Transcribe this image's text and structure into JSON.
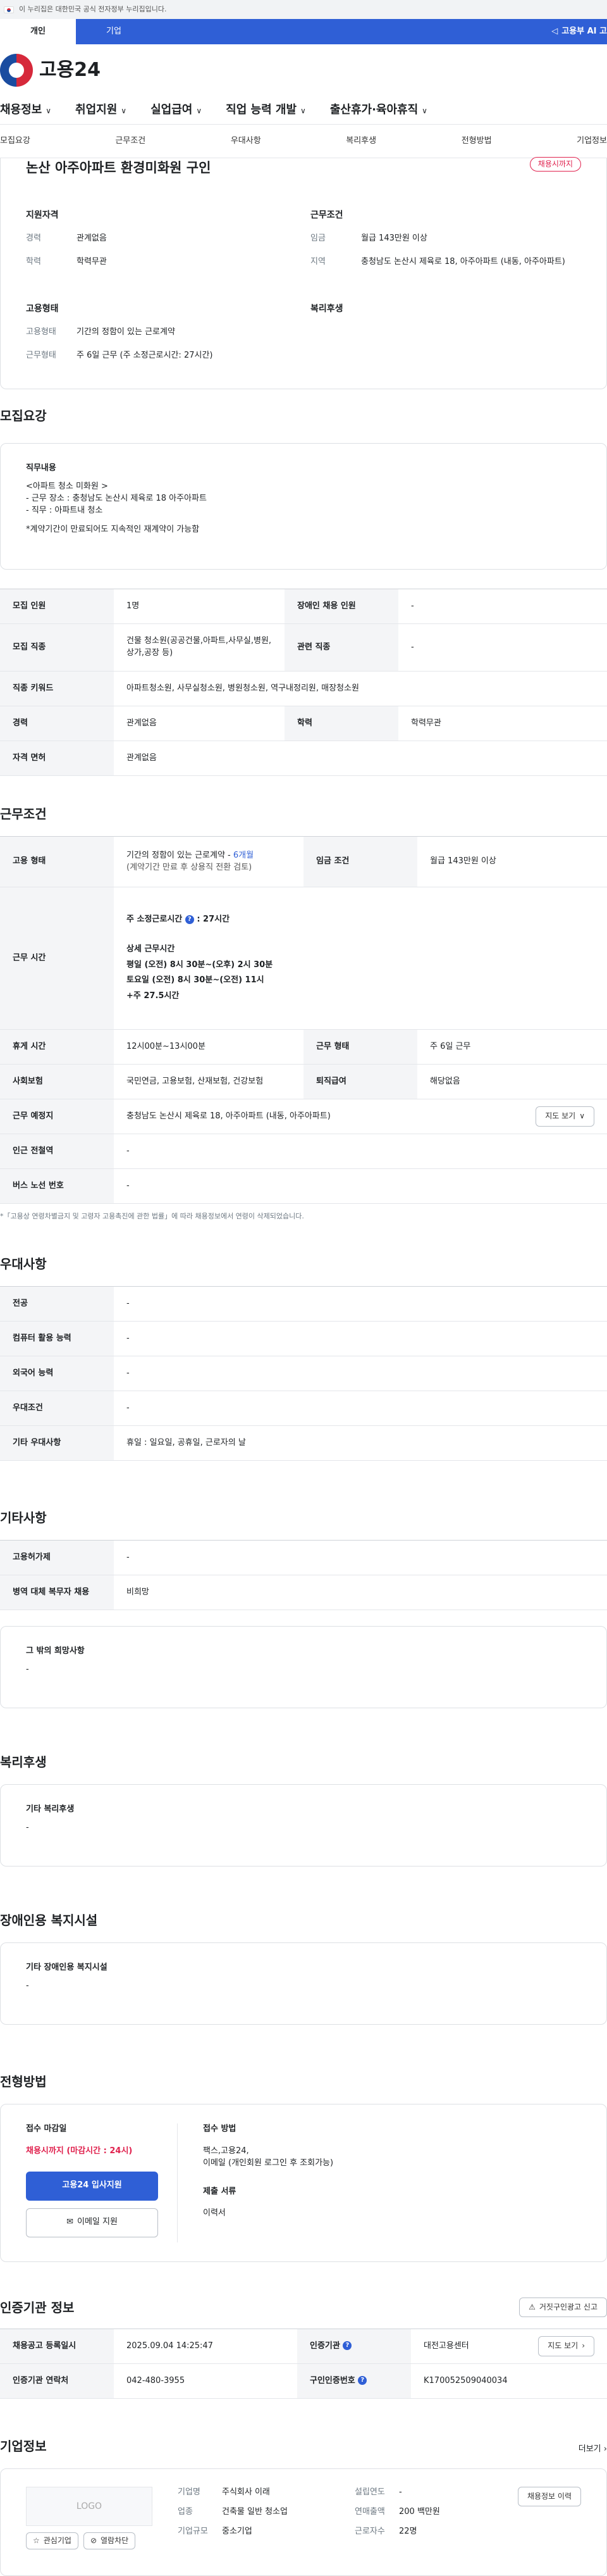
{
  "gov_banner": {
    "text": "이 누리집은 대한민국 공식 전자정부 누리집입니다."
  },
  "top_tabs": [
    {
      "label": "개인",
      "active": true
    },
    {
      "label": "기업",
      "active": false
    }
  ],
  "ai_link": "고용부 AI 고",
  "logo": {
    "text": "고용24"
  },
  "gnb": [
    "채용정보",
    "취업지원",
    "실업급여",
    "직업 능력 개발",
    "출산휴가·육아휴직"
  ],
  "subnav": [
    "모집요강",
    "근무조건",
    "우대사항",
    "복리후생",
    "전형방법",
    "기업정보"
  ],
  "job": {
    "title": "논산 아주아파트 환경미화원 구인",
    "status_badge": "채용시까지",
    "qual_title": "지원자격",
    "qual": [
      {
        "k": "경력",
        "v": "관계없음"
      },
      {
        "k": "학력",
        "v": "학력무관"
      }
    ],
    "cond_title": "근무조건",
    "cond": [
      {
        "k": "임금",
        "v": "월급 143만원 이상"
      },
      {
        "k": "지역",
        "v": "충청남도 논산시 제육로 18, 아주아파트 (내동, 아주아파트)"
      }
    ],
    "emp_title": "고용형태",
    "emp": [
      {
        "k": "고용형태",
        "v": "기간의 정함이 있는 근로계약"
      },
      {
        "k": "근무형태",
        "v": "주 6일 근무 (주 소정근로시간: 27시간)"
      }
    ],
    "welfare_title": "복리후생"
  },
  "recruit": {
    "heading": "모집요강",
    "duty_label": "직무내용",
    "duty_lines": [
      "<아파트 청소 미화원 >",
      "- 근무 장소 : 충청남도 논산시 제육로 18 아주아파트",
      "- 직무 : 아파트내 청소",
      "",
      "*계약기간이 만료되어도 지속적인 재계약이 가능함"
    ],
    "table": {
      "r1": {
        "k1": "모집 인원",
        "v1": "1명",
        "k2": "장애인 채용 인원",
        "v2": "-"
      },
      "r2": {
        "k1": "모집 직종",
        "v1": "건물 청소원(공공건물,아파트,사무실,병원,상가,공장 등)",
        "k2": "관련 직종",
        "v2": "-"
      },
      "r3": {
        "k1": "직종 키워드",
        "v1": "아파트청소원, 사무실청소원, 병원청소원, 역구내정리원, 매장청소원"
      },
      "r4": {
        "k1": "경력",
        "v1": "관계없음",
        "k2": "학력",
        "v2": "학력무관"
      },
      "r5": {
        "k1": "자격 면허",
        "v1": "관계없음"
      }
    }
  },
  "work": {
    "heading": "근무조건",
    "emp_type_k": "고용 형태",
    "emp_type_v1": "기간의 정함이 있는 근로계약 - ",
    "emp_type_months": "6개월",
    "emp_type_v2": "(계약기간 만료 후 상용직 전환 검토)",
    "wage_k": "임금 조건",
    "wage_v": "월급 143만원 이상",
    "hours_k": "근무 시간",
    "hours_main": "주 소정근로시간",
    "hours_main_val": ": 27시간",
    "hours_detail_label": "상세 근무시간",
    "hours_lines": [
      "평일 (오전) 8시 30분~(오후) 2시 30분",
      "토요일 (오전) 8시 30분~(오전) 11시",
      "+주 27.5시간"
    ],
    "break_k": "휴게 시간",
    "break_v": "12시00분~13시00분",
    "shift_k": "근무 형태",
    "shift_v": "주 6일 근무",
    "insurance_k": "사회보험",
    "insurance_v": "국민연금, 고용보험, 산재보험, 건강보험",
    "severance_k": "퇴직급여",
    "severance_v": "해당없음",
    "place_k": "근무 예정지",
    "place_v": "충청남도 논산시 제육로 18, 아주아파트 (내동, 아주아파트)",
    "map_btn": "지도 보기",
    "subway_k": "인근 전철역",
    "subway_v": "-",
    "bus_k": "버스 노선 번호",
    "bus_v": "-",
    "footnote": "「고용상 연령차별금지 및 고령자 고용촉진에 관한 법률」에 따라 채용정보에서 연령이 삭제되었습니다."
  },
  "pref": {
    "heading": "우대사항",
    "rows": [
      {
        "k": "전공",
        "v": "-"
      },
      {
        "k": "컴퓨터 활용 능력",
        "v": "-"
      },
      {
        "k": "외국어 능력",
        "v": "-"
      },
      {
        "k": "우대조건",
        "v": "-"
      },
      {
        "k": "기타 우대사항",
        "v": "휴일 : 일요일, 공휴일, 근로자의 날"
      }
    ]
  },
  "etc": {
    "heading": "기타사항",
    "rows": [
      {
        "k": "고용허가제",
        "v": "-"
      },
      {
        "k": "병역 대체 복무자 채용",
        "v": "비희망"
      }
    ],
    "other_label": "그 밖의 희망사항",
    "other_value": "-"
  },
  "welfare": {
    "heading": "복리후생",
    "label": "기타 복리후생",
    "value": "-"
  },
  "disab": {
    "heading": "장애인용 복지시설",
    "label": "기타 장애인용 복지시설",
    "value": "-"
  },
  "process": {
    "heading": "전형방법",
    "deadline_label": "접수 마감일",
    "deadline_value": "채용시까지 (마감시간 : 24시)",
    "apply_btn": "고용24 입사지원",
    "email_btn": "이메일 지원",
    "method_label": "접수 방법",
    "method_lines": [
      "팩스,고용24,",
      "이메일 (개인회원 로그인 후 조회가능)"
    ],
    "docs_label": "제출 서류",
    "docs_value": "이력서"
  },
  "agency": {
    "heading": "인증기관 정보",
    "report_btn": "거짓구인광고 신고",
    "reg_k": "채용공고 등록일시",
    "reg_v": "2025.09.04 14:25:47",
    "org_k": "인증기관",
    "org_v": "대전고용센터",
    "contact_k": "인증기관 연락처",
    "contact_v": "042-480-3955",
    "id_k": "구인인증번호",
    "id_v": "K170052509040034",
    "map_btn": "지도 보기"
  },
  "company": {
    "heading": "기업정보",
    "more": "더보기",
    "logo_text": "LOGO",
    "fav_btn": "관심기업",
    "block_btn": "열람차단",
    "name_k": "기업명",
    "name_v": "주식회사 이래",
    "industry_k": "업종",
    "industry_v": "건축물 일반 청소업",
    "size_k": "기업규모",
    "size_v": "중소기업",
    "founded_k": "설립연도",
    "founded_v": "-",
    "sales_k": "연매출액",
    "sales_v": "200 백만원",
    "staff_k": "근로자수",
    "staff_v": "22명",
    "history_btn": "채용정보 이력"
  },
  "colors": {
    "primary": "#2f5fd6",
    "danger": "#e0224e"
  }
}
